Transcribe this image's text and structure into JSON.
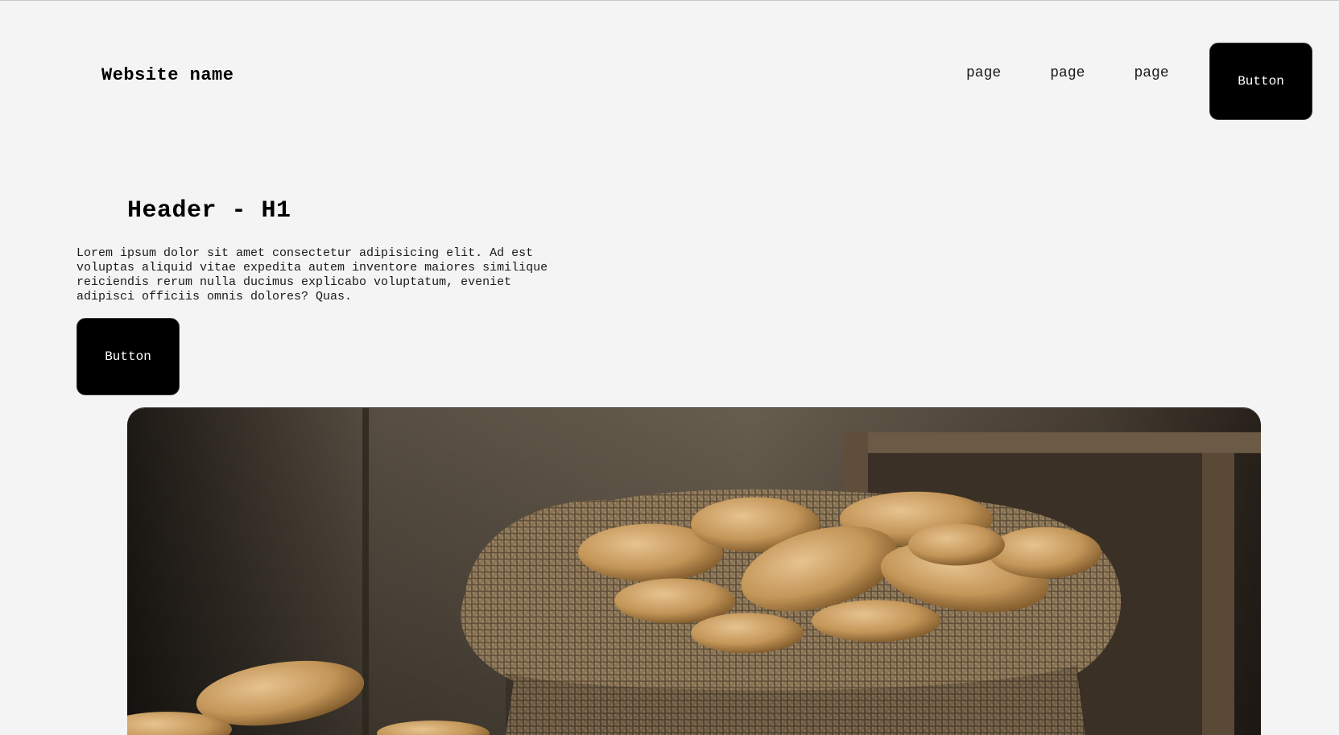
{
  "header": {
    "site_name": "Website name",
    "nav": [
      {
        "label": "page"
      },
      {
        "label": "page"
      },
      {
        "label": "page"
      }
    ],
    "button_label": "Button"
  },
  "hero": {
    "title": "Header - H1",
    "text": "Lorem ipsum dolor sit amet consectetur adipisicing elit. Ad est voluptas aliquid vitae expedita autem inventore maiores similique reiciendis rerum nulla ducimus explicabo voluptatum, eveniet adipisci officiis omnis dolores? Quas.",
    "button_label": "Button"
  },
  "colors": {
    "background": "#f4f4f4",
    "button": "#000000",
    "button_text": "#ffffff"
  }
}
